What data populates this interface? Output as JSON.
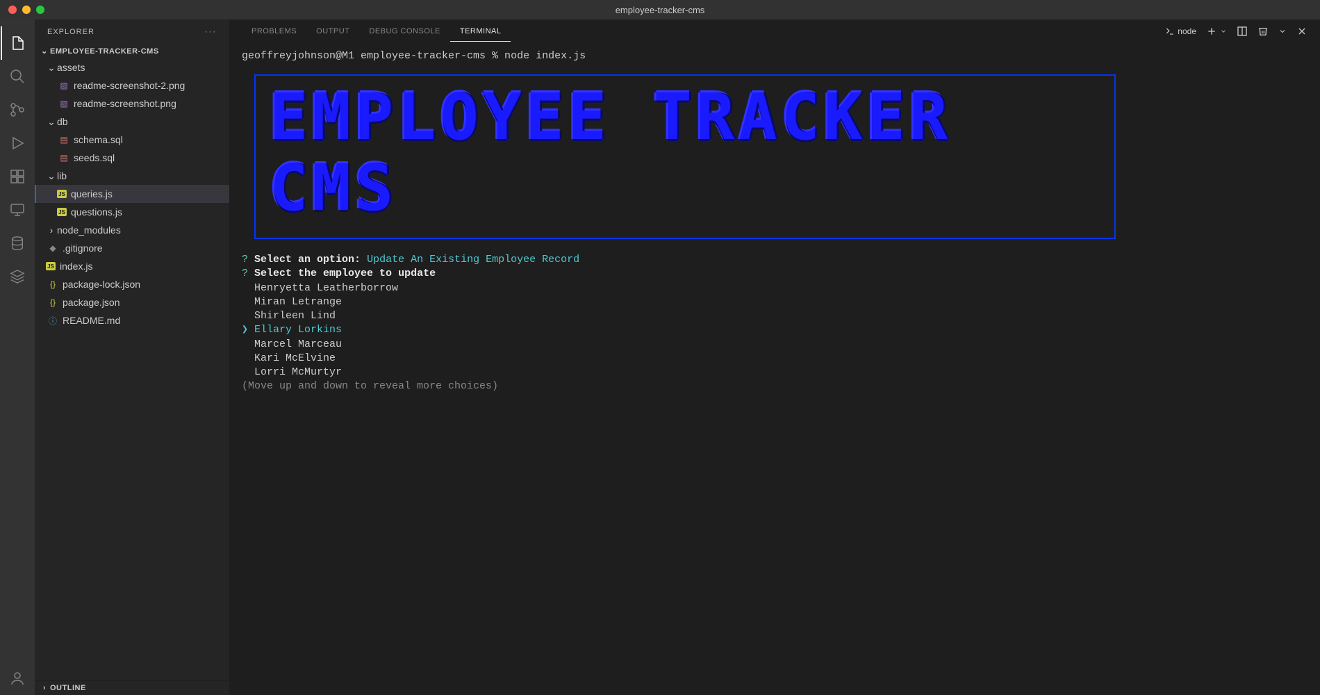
{
  "window": {
    "title": "employee-tracker-cms"
  },
  "sidebar": {
    "header": "EXPLORER",
    "project": "EMPLOYEE-TRACKER-CMS",
    "outline": "OUTLINE",
    "tree": {
      "assets": "assets",
      "assets_items": [
        "readme-screenshot-2.png",
        "readme-screenshot.png"
      ],
      "db": "db",
      "db_items": [
        "schema.sql",
        "seeds.sql"
      ],
      "lib": "lib",
      "lib_items": [
        "queries.js",
        "questions.js"
      ],
      "node_modules": "node_modules",
      "gitignore": ".gitignore",
      "index": "index.js",
      "pkglock": "package-lock.json",
      "pkg": "package.json",
      "readme": "README.md"
    }
  },
  "panel": {
    "tabs": [
      "PROBLEMS",
      "OUTPUT",
      "DEBUG CONSOLE",
      "TERMINAL"
    ],
    "shell": "node"
  },
  "terminal": {
    "prompt": "geoffreyjohnson@M1 employee-tracker-cms % node index.js",
    "banner1": "EMPLOYEE TRACKER",
    "banner2": "CMS",
    "q1_prefix": "?",
    "q1_label": "Select an option:",
    "q1_answer": "Update An Existing Employee Record",
    "q2_prefix": "?",
    "q2_label": "Select the employee to update",
    "options": [
      "Henryetta Leatherborrow",
      "Miran Letrange",
      "Shirleen Lind",
      "Ellary Lorkins",
      "Marcel Marceau",
      "Kari McElvine",
      "Lorri McMurtyr"
    ],
    "selected_index": 3,
    "hint": "(Move up and down to reveal more choices)"
  }
}
